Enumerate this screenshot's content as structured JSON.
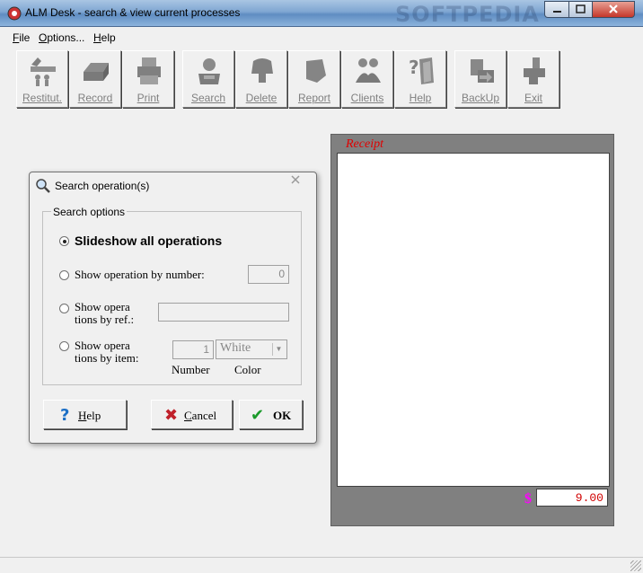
{
  "window": {
    "title": "ALM Desk - search & view current processes",
    "watermark": "SOFTPEDIA"
  },
  "menu": {
    "items": [
      {
        "label": "File",
        "mnemonic": "F"
      },
      {
        "label": "Options...",
        "mnemonic": "O"
      },
      {
        "label": "Help",
        "mnemonic": "H"
      }
    ]
  },
  "toolbar": {
    "buttons": [
      {
        "label": "Restitut.",
        "icon": "restitution-icon"
      },
      {
        "label": "Record",
        "icon": "record-icon"
      },
      {
        "label": "Print",
        "icon": "print-icon"
      },
      {
        "label": "Search",
        "icon": "search-icon"
      },
      {
        "label": "Delete",
        "icon": "delete-icon"
      },
      {
        "label": "Report",
        "icon": "report-icon"
      },
      {
        "label": "Clients",
        "icon": "clients-icon"
      },
      {
        "label": "Help",
        "icon": "help-icon"
      },
      {
        "label": "BackUp",
        "icon": "backup-icon"
      },
      {
        "label": "Exit",
        "icon": "exit-icon"
      }
    ]
  },
  "receipt": {
    "title": "Receipt",
    "currency_symbol": "$",
    "total": "9.00",
    "colors": {
      "title": "#e00000",
      "currency": "#ff00ff",
      "total": "#d00000"
    }
  },
  "dialog": {
    "title": "Search operation(s)",
    "group_label": "Search options",
    "options": {
      "slideshow": "Slideshow all operations",
      "by_number": "Show operation by number:",
      "by_ref_line1": "Show opera",
      "by_ref_line2": "tions by ref.:",
      "by_item_line1": "Show opera",
      "by_item_line2": "tions by item:"
    },
    "selected_option": "slideshow",
    "number_value": "0",
    "ref_value": "",
    "item_number_value": "1",
    "color_value": "White",
    "number_label": "Number",
    "color_label": "Color",
    "buttons": {
      "help": "Help",
      "cancel": "Cancel",
      "ok": "OK"
    }
  }
}
